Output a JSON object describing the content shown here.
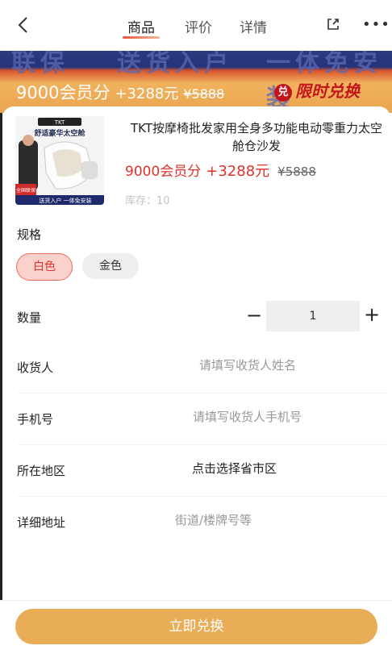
{
  "header": {
    "tabs": [
      "商品",
      "评价",
      "详情"
    ],
    "active_tab": 0,
    "icons": {
      "back": "back-icon",
      "share": "share-icon",
      "more": "more-icon"
    }
  },
  "banner": {
    "top_words": [
      "联保",
      "送货入户",
      "一体免安装"
    ],
    "points": "9000会员分",
    "cash": "+3288元",
    "original": "¥5888",
    "badge": "限时兑换",
    "badge_glyph": "兑"
  },
  "product": {
    "thumbnail_text": {
      "brand": "TKT",
      "headline": "舒适豪华太空舱",
      "corner": "全国联保",
      "footer": "送货入户  一体免安装"
    },
    "name": "TKT按摩椅批发家用全身多功能电动零重力太空舱仓沙发",
    "points": "9000会员分",
    "cash": "+3288元",
    "original": "¥5888",
    "stock": "库存：10"
  },
  "spec": {
    "label": "规格",
    "options": [
      "白色",
      "金色"
    ],
    "selected": "白色"
  },
  "quantity": {
    "label": "数量",
    "minus": "−",
    "value": "1",
    "plus": "+"
  },
  "form": {
    "receiver": {
      "label": "收货人",
      "placeholder": "请填写收货人姓名"
    },
    "phone": {
      "label": "手机号",
      "placeholder": "请填写收货人手机号"
    },
    "region": {
      "label": "所在地区",
      "value": "点击选择省市区"
    },
    "address": {
      "label": "详细地址",
      "placeholder": "街道/楼牌号等"
    }
  },
  "footer": {
    "button": "立即兑换"
  },
  "colors": {
    "accent": "#e0322b",
    "cta": "#e9ad58",
    "chip_bg": "#fbd1cc"
  }
}
